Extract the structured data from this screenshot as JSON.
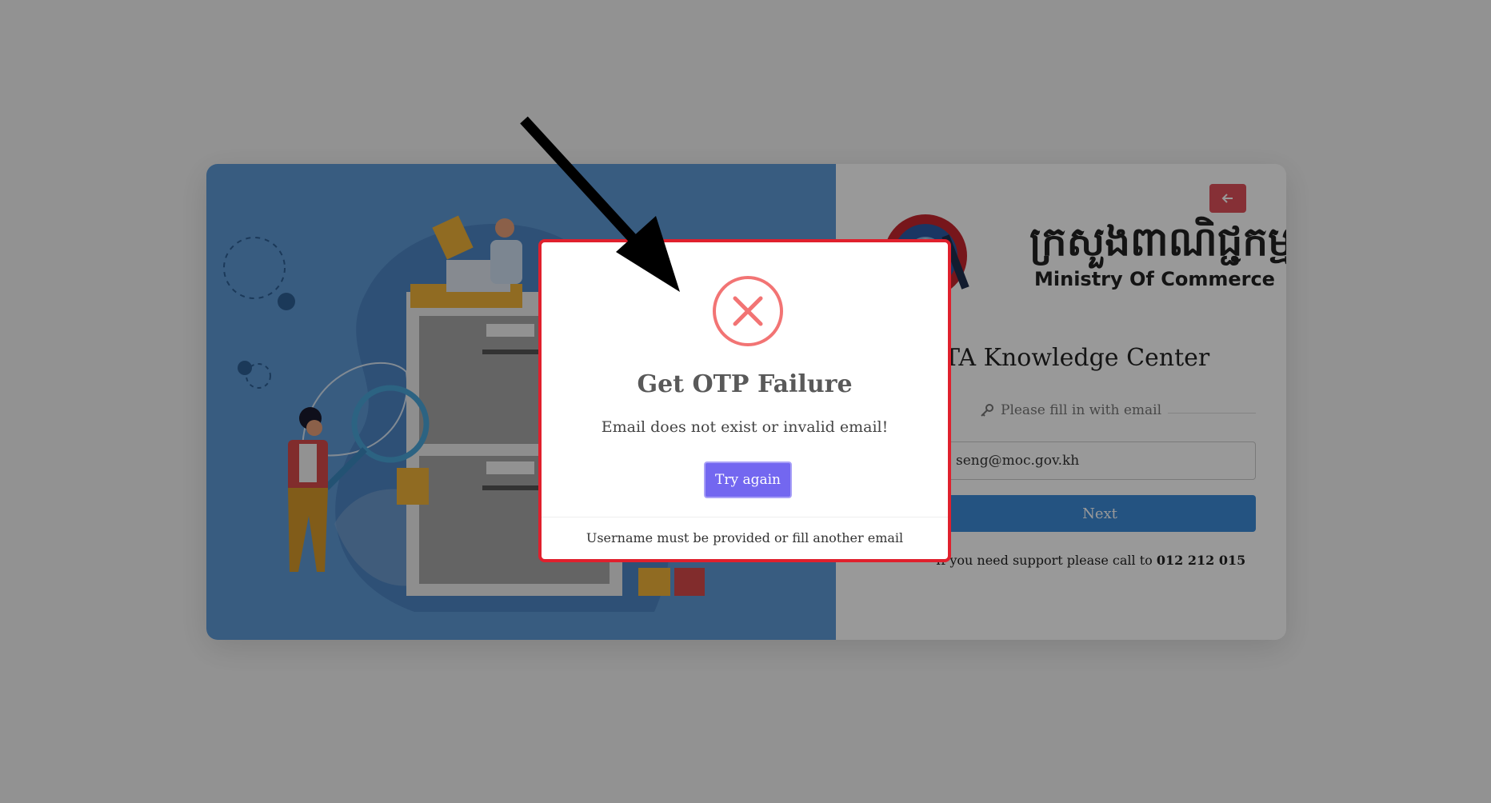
{
  "header": {
    "logo_khmer": "ក្រសួងពាណិជ្ជកម្ម",
    "logo_english": "Ministry Of Commerce",
    "app_title": "TA Knowledge Center"
  },
  "form": {
    "hint": "Please fill in with email",
    "email_value": "seng@moc.gov.kh",
    "next_label": "Next",
    "support_text": "If you need support please call to",
    "support_phone": "012 212 015"
  },
  "dialog": {
    "title": "Get OTP Failure",
    "message": "Email does not exist or invalid email!",
    "button_label": "Try again",
    "footer": "Username must be provided or fill another email"
  },
  "colors": {
    "brand_blue": "#3d8ad8",
    "illustration_bg": "#5e9ad6",
    "back_button": "#e0515b",
    "dialog_button": "#7367f0",
    "error_icon": "#f27474",
    "highlight_border": "#e0202d"
  },
  "icons": [
    "arrow-left-icon",
    "key-icon",
    "error-x-icon",
    "annotation-arrow"
  ]
}
